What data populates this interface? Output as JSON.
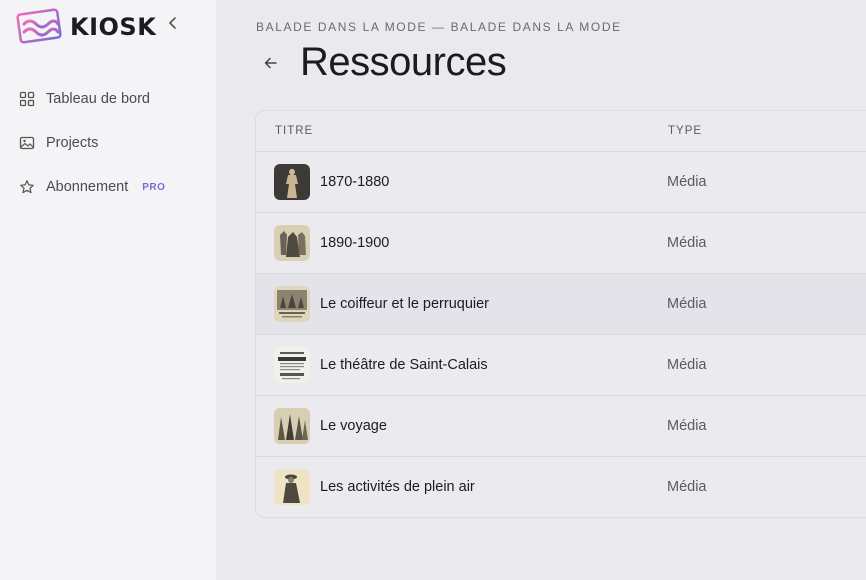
{
  "app": {
    "name": "KIOSK",
    "logo_icon": "kiosk-wave-logo"
  },
  "sidebar": {
    "collapse_icon": "chevron-left-icon",
    "items": [
      {
        "label": "Tableau de bord",
        "icon": "grid-icon"
      },
      {
        "label": "Projects",
        "icon": "image-icon"
      },
      {
        "label": "Abonnement",
        "icon": "star-icon",
        "badge": "PRO"
      }
    ]
  },
  "header": {
    "breadcrumb": "BALADE DANS LA MODE — BALADE DANS LA MODE",
    "back_icon": "arrow-left-icon",
    "title": "Ressources"
  },
  "table": {
    "columns": [
      "TITRE",
      "TYPE"
    ],
    "rows": [
      {
        "title": "1870-1880",
        "type": "Média",
        "thumb": "dress-photo-thumbnail"
      },
      {
        "title": "1890-1900",
        "type": "Média",
        "thumb": "fashion-engraving-thumbnail"
      },
      {
        "title": "Le coiffeur et le perruquier",
        "type": "Média",
        "thumb": "engraving-thumbnail"
      },
      {
        "title": "Le théâtre de Saint-Calais",
        "type": "Média",
        "thumb": "document-thumbnail"
      },
      {
        "title": "Le voyage",
        "type": "Média",
        "thumb": "engraving-thumbnail"
      },
      {
        "title": "Les activités de plein air",
        "type": "Média",
        "thumb": "engraving-thumbnail"
      }
    ]
  },
  "colors": {
    "accent": "#7a6ad8",
    "sidebar_bg": "#f4f4f7",
    "main_bg": "#eae9ee"
  }
}
